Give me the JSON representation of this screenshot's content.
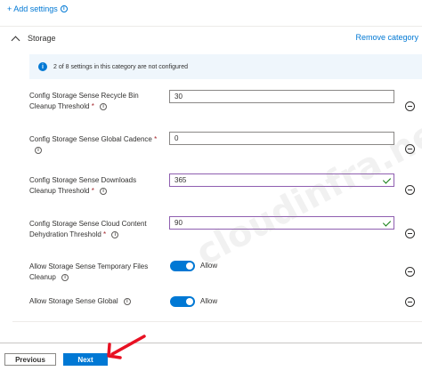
{
  "header": {
    "add_settings_label": "+ Add settings"
  },
  "section": {
    "title": "Storage",
    "remove_label": "Remove category"
  },
  "info_bar": {
    "message": "2 of 8 settings in this category are not configured"
  },
  "settings": [
    {
      "label_line1": "Config Storage Sense Recycle Bin",
      "label_line2": "Cleanup Threshold",
      "required": "*",
      "value": "30"
    },
    {
      "label_line1": "Config Storage Sense Global Cadence",
      "label_line2": "",
      "required": "*",
      "value": "0"
    },
    {
      "label_line1": "Config Storage Sense Downloads",
      "label_line2": "Cleanup Threshold",
      "required": "*",
      "value": "365"
    },
    {
      "label_line1": "Config Storage Sense Cloud Content",
      "label_line2": "Dehydration Threshold",
      "required": "*",
      "value": "90"
    }
  ],
  "toggles": [
    {
      "label_line1": "Allow Storage Sense Temporary Files",
      "label_line2": "Cleanup",
      "state_label": "Allow",
      "on": true
    },
    {
      "label_line1": "Allow Storage Sense Global",
      "state_label": "Allow",
      "on": true
    }
  ],
  "footer": {
    "previous_label": "Previous",
    "next_label": "Next"
  },
  "watermark": "cloudinfra.net",
  "colors": {
    "accent": "#0078d4",
    "required": "#a4262c",
    "valid_check": "#107c10",
    "info_bg": "#eff6fc",
    "arrow": "#e81123"
  }
}
